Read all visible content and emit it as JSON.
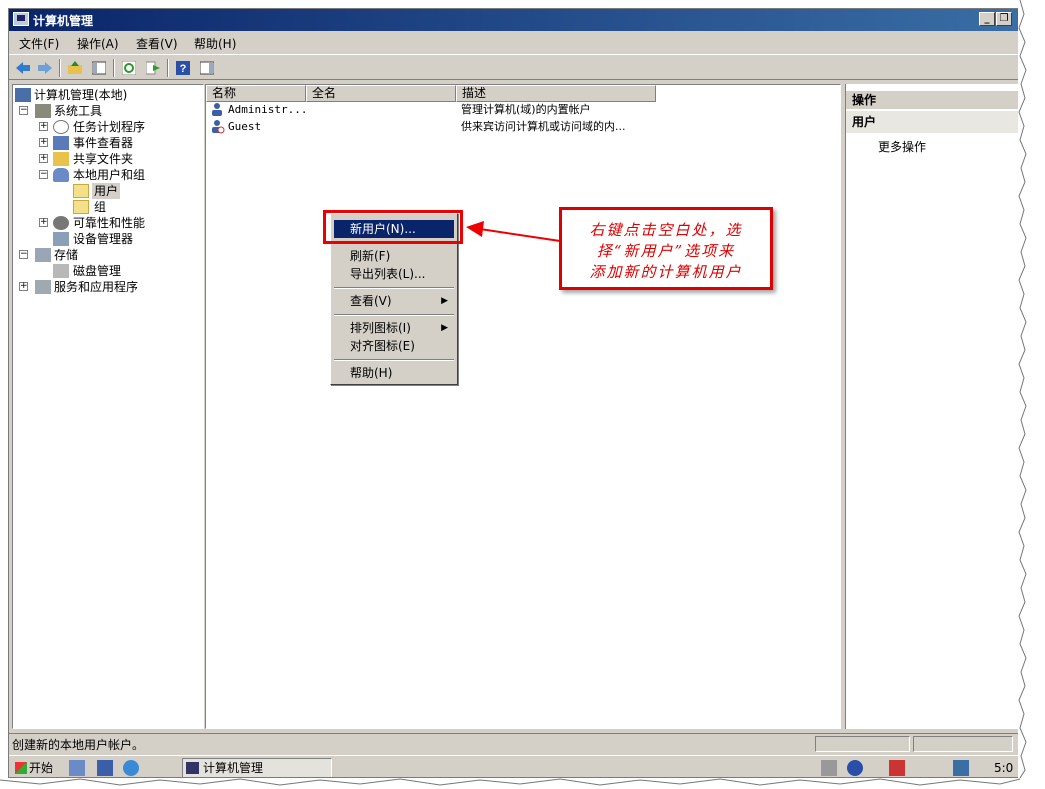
{
  "window": {
    "title": "计算机管理"
  },
  "menubar": [
    "文件(F)",
    "操作(A)",
    "查看(V)",
    "帮助(H)"
  ],
  "toolbar_icons": [
    "back-icon",
    "forward-icon",
    "up-folder-icon",
    "show-hide-console-tree-icon",
    "refresh-icon",
    "export-list-icon",
    "help-icon",
    "properties-pane-icon"
  ],
  "tree": {
    "root": "计算机管理(本地)",
    "system_tools": "系统工具",
    "task_scheduler": "任务计划程序",
    "event_viewer": "事件查看器",
    "shared_folders": "共享文件夹",
    "local_users_groups": "本地用户和组",
    "users": "用户",
    "groups": "组",
    "reliability": "可靠性和性能",
    "device_manager": "设备管理器",
    "storage": "存储",
    "disk_management": "磁盘管理",
    "services_apps": "服务和应用程序"
  },
  "list": {
    "columns": [
      "名称",
      "全名",
      "描述"
    ],
    "rows": [
      {
        "name": "Administr...",
        "full_name": "",
        "description": "管理计算机(域)的内置帐户"
      },
      {
        "name": "Guest",
        "full_name": "",
        "description": "供来宾访问计算机或访问域的内..."
      }
    ]
  },
  "actions": {
    "header": "操作",
    "section": "用户",
    "more": "更多操作"
  },
  "context_menu": {
    "new_user": "新用户(N)...",
    "refresh": "刷新(F)",
    "export_list": "导出列表(L)...",
    "view": "查看(V)",
    "arrange_icons": "排列图标(I)",
    "line_up_icons": "对齐图标(E)",
    "help": "帮助(H)"
  },
  "callout": {
    "line1": "右键点击空白处，选",
    "line2": "择“新用户”选项来",
    "line3": "添加新的计算机用户"
  },
  "status": {
    "text": "创建新的本地用户帐户。"
  },
  "taskbar": {
    "start": "开始",
    "task": "计算机管理",
    "clock": "5:0"
  },
  "colors": {
    "title_bar": "#0a246a",
    "highlight": "#0a246a",
    "annotation_red": "#dd0000",
    "chrome": "#d4d0c8"
  }
}
